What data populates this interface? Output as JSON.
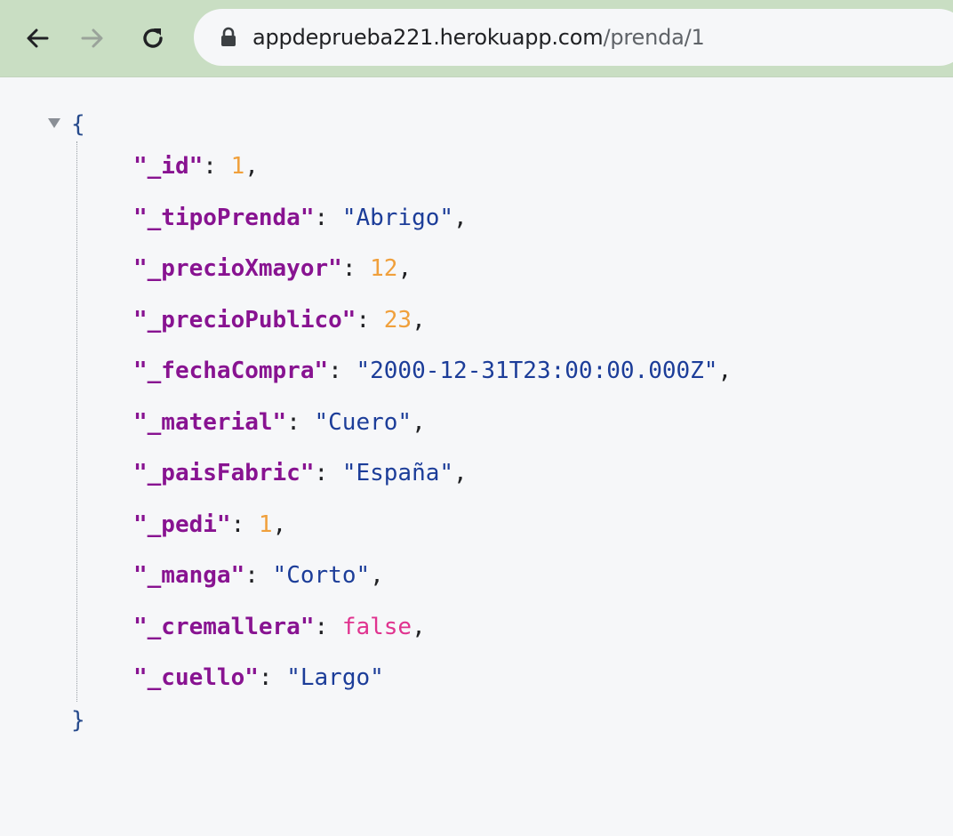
{
  "browser": {
    "url_host": "appdeprueba221.herokuapp.com",
    "url_path": "/prenda/1",
    "icons": {
      "back": "back-arrow-icon",
      "forward": "forward-arrow-icon",
      "reload": "reload-icon",
      "lock": "lock-icon"
    }
  },
  "json_viewer": {
    "open_brace": "{",
    "close_brace": "}",
    "entries": [
      {
        "key": "\"_id\"",
        "value": "1",
        "type": "number",
        "trail": ","
      },
      {
        "key": "\"_tipoPrenda\"",
        "value": "\"Abrigo\"",
        "type": "string",
        "trail": ","
      },
      {
        "key": "\"_precioXmayor\"",
        "value": "12",
        "type": "number",
        "trail": ","
      },
      {
        "key": "\"_precioPublico\"",
        "value": "23",
        "type": "number",
        "trail": ","
      },
      {
        "key": "\"_fechaCompra\"",
        "value": "\"2000-12-31T23:00:00.000Z\"",
        "type": "string",
        "trail": ","
      },
      {
        "key": "\"_material\"",
        "value": "\"Cuero\"",
        "type": "string",
        "trail": ","
      },
      {
        "key": "\"_paisFabric\"",
        "value": "\"España\"",
        "type": "string",
        "trail": ","
      },
      {
        "key": "\"_pedi\"",
        "value": "1",
        "type": "number",
        "trail": ","
      },
      {
        "key": "\"_manga\"",
        "value": "\"Corto\"",
        "type": "string",
        "trail": ","
      },
      {
        "key": "\"_cremallera\"",
        "value": "false",
        "type": "boolean",
        "trail": ","
      },
      {
        "key": "\"_cuello\"",
        "value": "\"Largo\"",
        "type": "string",
        "trail": ""
      }
    ]
  }
}
